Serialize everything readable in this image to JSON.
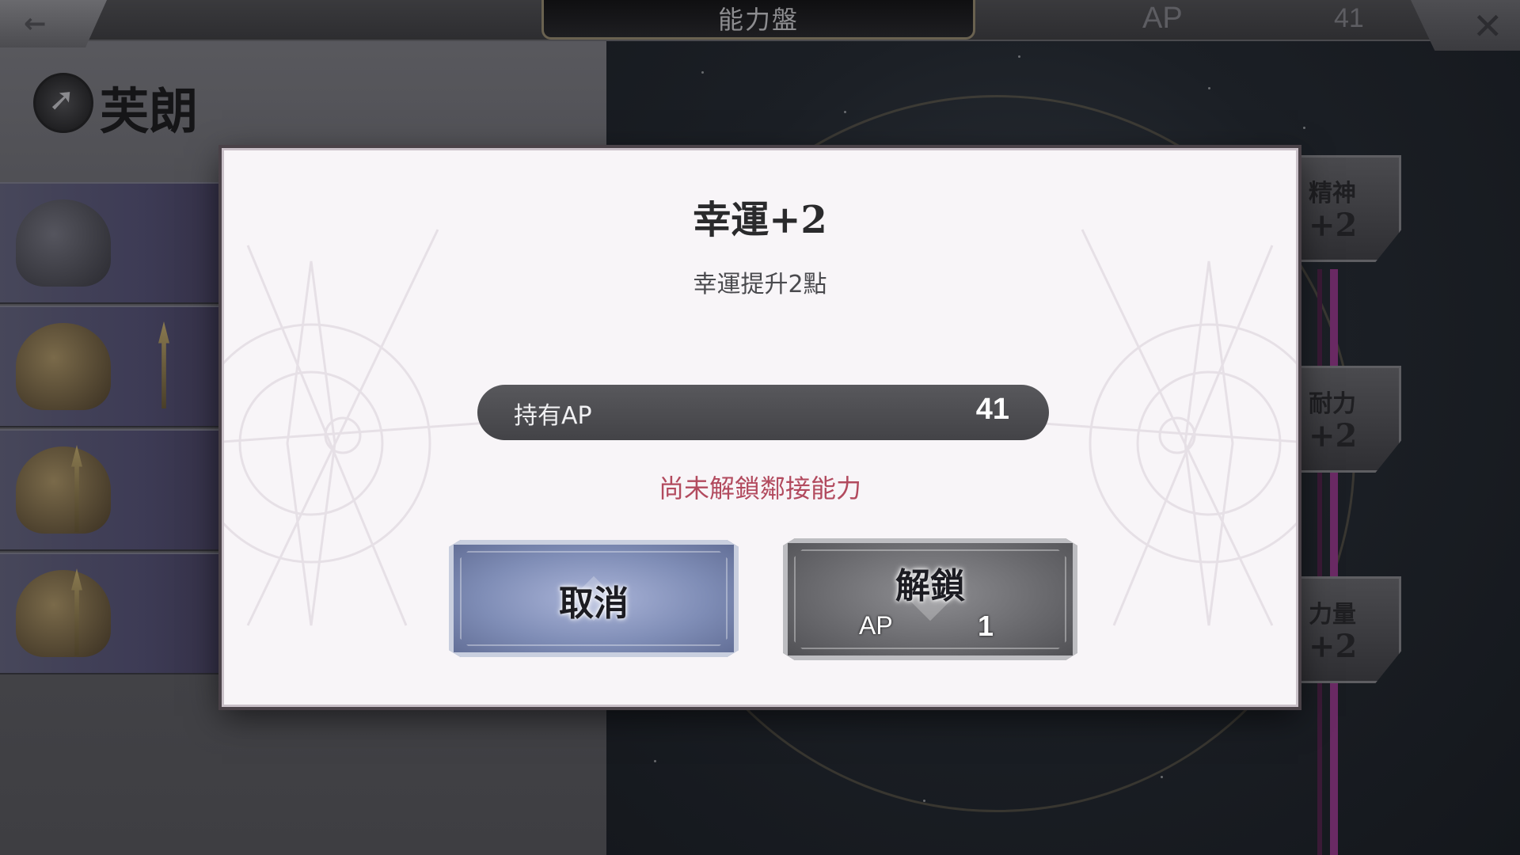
{
  "screen": {
    "title": "能力盤",
    "ap_label": "AP",
    "ap_value": "41"
  },
  "character": {
    "name": "芙朗"
  },
  "board_nodes": [
    {
      "label": "精神",
      "value": "+2"
    },
    {
      "label": "耐力",
      "value": "+2"
    },
    {
      "label": "力量",
      "value": "+2"
    }
  ],
  "dialog": {
    "title": "幸運+2",
    "description": "幸運提升2點",
    "ap_bar_label": "持有AP",
    "ap_bar_value": "41",
    "warning": "尚未解鎖鄰接能力",
    "cancel_label": "取消",
    "unlock_label": "解鎖",
    "unlock_cost_label": "AP",
    "unlock_cost_value": "1"
  },
  "colors": {
    "warning_text": "#b24a5e",
    "cancel_button": "#7f8db6",
    "unlock_button": "#6a6a6e"
  }
}
